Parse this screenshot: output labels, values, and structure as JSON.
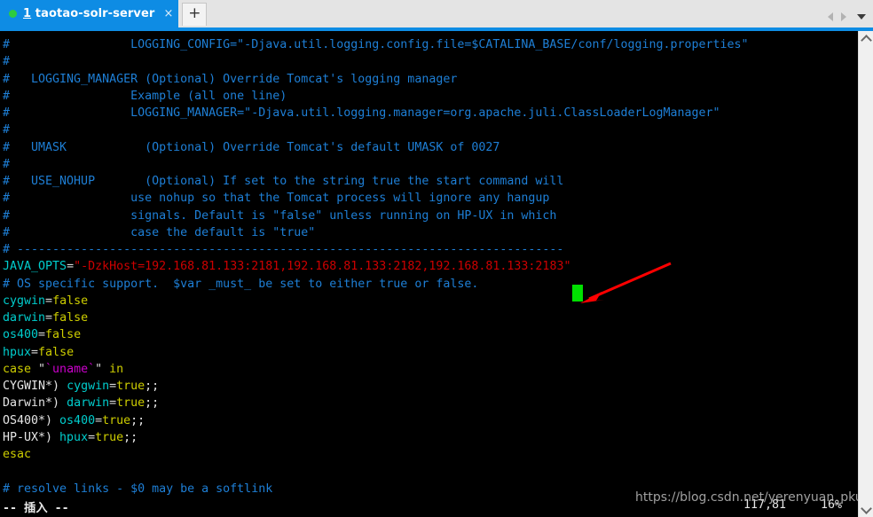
{
  "window": {
    "tab": {
      "number": "1",
      "title": "taotao-solr-server",
      "close_label": "×",
      "status_dot_color": "#2ecc40"
    },
    "new_tab_label": "+",
    "nav": {
      "prev_icon": "triangle-left-icon",
      "next_icon": "triangle-right-icon",
      "menu_icon": "caret-down-icon"
    }
  },
  "terminal": {
    "lines": [
      {
        "id": "l1",
        "segments": [
          {
            "text": "#                 LOGGING_CONFIG=\"-Djava.util.logging.config.file=$CATALINA_BASE/conf/logging.properties\"",
            "style": "comment"
          }
        ]
      },
      {
        "id": "l2",
        "segments": [
          {
            "text": "#",
            "style": "comment"
          }
        ]
      },
      {
        "id": "l3",
        "segments": [
          {
            "text": "#   LOGGING_MANAGER (Optional) Override Tomcat's logging manager",
            "style": "comment"
          }
        ]
      },
      {
        "id": "l4",
        "segments": [
          {
            "text": "#                 Example (all one line)",
            "style": "comment"
          }
        ]
      },
      {
        "id": "l5",
        "segments": [
          {
            "text": "#                 LOGGING_MANAGER=\"-Djava.util.logging.manager=org.apache.juli.ClassLoaderLogManager\"",
            "style": "comment"
          }
        ]
      },
      {
        "id": "l6",
        "segments": [
          {
            "text": "#",
            "style": "comment"
          }
        ]
      },
      {
        "id": "l7",
        "segments": [
          {
            "text": "#   UMASK           (Optional) Override Tomcat's default UMASK of 0027",
            "style": "comment"
          }
        ]
      },
      {
        "id": "l8",
        "segments": [
          {
            "text": "#",
            "style": "comment"
          }
        ]
      },
      {
        "id": "l9",
        "segments": [
          {
            "text": "#   USE_NOHUP       (Optional) If set to the string true the start command will",
            "style": "comment"
          }
        ]
      },
      {
        "id": "l10",
        "segments": [
          {
            "text": "#                 use nohup so that the Tomcat process will ignore any hangup",
            "style": "comment"
          }
        ]
      },
      {
        "id": "l11",
        "segments": [
          {
            "text": "#                 signals. Default is \"false\" unless running on HP-UX in which",
            "style": "comment"
          }
        ]
      },
      {
        "id": "l12",
        "segments": [
          {
            "text": "#                 case the default is \"true\"",
            "style": "comment"
          }
        ]
      },
      {
        "id": "l13",
        "segments": [
          {
            "text": "# -----------------------------------------------------------------------------",
            "style": "comment"
          }
        ]
      },
      {
        "id": "l14",
        "segments": [
          {
            "text": "JAVA_OPTS",
            "style": "var"
          },
          {
            "text": "=",
            "style": "plain"
          },
          {
            "text": "\"-DzkHost=192.168.81.133:2181,192.168.81.133:2182,192.168.81.133:2183\"",
            "style": "str"
          }
        ]
      },
      {
        "id": "l15",
        "segments": [
          {
            "text": "# OS specific support.  $var _must_ be set to either true or false.",
            "style": "comment"
          }
        ]
      },
      {
        "id": "l16",
        "segments": [
          {
            "text": "cygwin",
            "style": "var"
          },
          {
            "text": "=",
            "style": "plain"
          },
          {
            "text": "false",
            "style": "val"
          }
        ]
      },
      {
        "id": "l17",
        "segments": [
          {
            "text": "darwin",
            "style": "var"
          },
          {
            "text": "=",
            "style": "plain"
          },
          {
            "text": "false",
            "style": "val"
          }
        ]
      },
      {
        "id": "l18",
        "segments": [
          {
            "text": "os400",
            "style": "var"
          },
          {
            "text": "=",
            "style": "plain"
          },
          {
            "text": "false",
            "style": "val"
          }
        ]
      },
      {
        "id": "l19",
        "segments": [
          {
            "text": "hpux",
            "style": "var"
          },
          {
            "text": "=",
            "style": "plain"
          },
          {
            "text": "false",
            "style": "val"
          }
        ]
      },
      {
        "id": "l20",
        "segments": [
          {
            "text": "case",
            "style": "val"
          },
          {
            "text": " \"",
            "style": "plain"
          },
          {
            "text": "`uname`",
            "style": "magenta"
          },
          {
            "text": "\" ",
            "style": "plain"
          },
          {
            "text": "in",
            "style": "val"
          }
        ]
      },
      {
        "id": "l21",
        "segments": [
          {
            "text": "CYGWIN*) ",
            "style": "white"
          },
          {
            "text": "cygwin",
            "style": "var"
          },
          {
            "text": "=",
            "style": "plain"
          },
          {
            "text": "true",
            "style": "val"
          },
          {
            "text": ";;",
            "style": "white"
          }
        ]
      },
      {
        "id": "l22",
        "segments": [
          {
            "text": "Darwin*) ",
            "style": "white"
          },
          {
            "text": "darwin",
            "style": "var"
          },
          {
            "text": "=",
            "style": "plain"
          },
          {
            "text": "true",
            "style": "val"
          },
          {
            "text": ";;",
            "style": "white"
          }
        ]
      },
      {
        "id": "l23",
        "segments": [
          {
            "text": "OS400*) ",
            "style": "white"
          },
          {
            "text": "os400",
            "style": "var"
          },
          {
            "text": "=",
            "style": "plain"
          },
          {
            "text": "true",
            "style": "val"
          },
          {
            "text": ";;",
            "style": "white"
          }
        ]
      },
      {
        "id": "l24",
        "segments": [
          {
            "text": "HP-UX*) ",
            "style": "white"
          },
          {
            "text": "hpux",
            "style": "var"
          },
          {
            "text": "=",
            "style": "plain"
          },
          {
            "text": "true",
            "style": "val"
          },
          {
            "text": ";;",
            "style": "white"
          }
        ]
      },
      {
        "id": "l25",
        "segments": [
          {
            "text": "esac",
            "style": "val"
          }
        ]
      },
      {
        "id": "l26",
        "segments": [
          {
            "text": "",
            "style": "plain"
          }
        ]
      },
      {
        "id": "l27",
        "segments": [
          {
            "text": "# resolve links - $0 may be a softlink",
            "style": "comment"
          }
        ]
      }
    ],
    "cursor": {
      "name": "text-cursor-block",
      "color": "#00e000"
    },
    "annotation": {
      "name": "red-arrow-annotation",
      "color": "#ff0000"
    }
  },
  "statusbar": {
    "mode": "-- 插入 --",
    "position": "117,81",
    "percent": "16%"
  },
  "watermark": {
    "text": "https://blog.csdn.net/yerenyuan_pku"
  },
  "scrollbar": {
    "up_icon": "chevron-up-icon",
    "down_icon": "chevron-down-icon"
  },
  "colors": {
    "tab_active": "#0e8ce4",
    "comment": "#1e7fd6",
    "variable": "#00cdcd",
    "string": "#cd0000",
    "value": "#cdcd00",
    "magenta": "#cd00cd",
    "cursor": "#00e000",
    "arrow": "#ff0000"
  }
}
